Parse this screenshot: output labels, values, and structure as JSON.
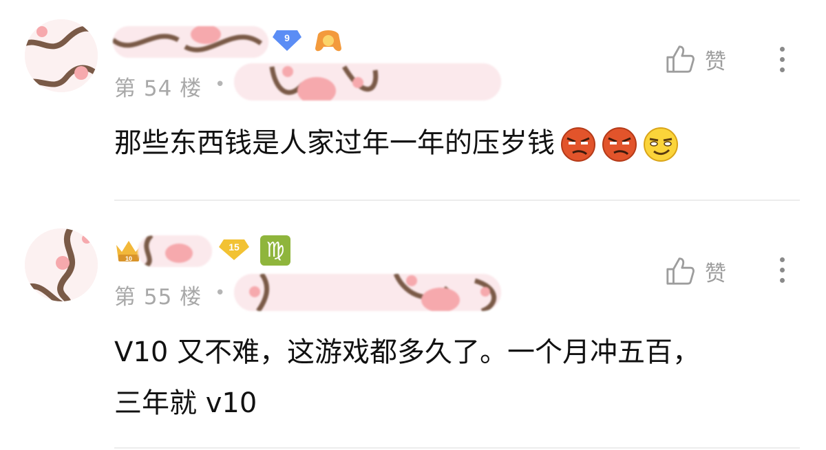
{
  "comments": [
    {
      "floor": "第 54 楼",
      "separator": "•",
      "level_badge": "9",
      "text": "那些东西钱是人家过年一年的压岁钱",
      "like_label": "赞",
      "emojis": [
        "angry-face-emoji",
        "angry-face-emoji",
        "smirk-face-emoji"
      ]
    },
    {
      "floor": "第 55 楼",
      "separator": "•",
      "level_badge": "15",
      "vip_badge": "10",
      "zodiac": "♍",
      "text_line1": "V10 又不难，这游戏都多久了。一个月冲五百，",
      "text_line2": "三年就 v10",
      "like_label": "赞"
    }
  ],
  "colors": {
    "pink_pattern": "#f6a9ad",
    "brown_pattern": "#7a5a47",
    "level9_badge": "#5b8df5",
    "level15_badge": "#f2c233",
    "zodiac_badge": "#8fb53c"
  }
}
